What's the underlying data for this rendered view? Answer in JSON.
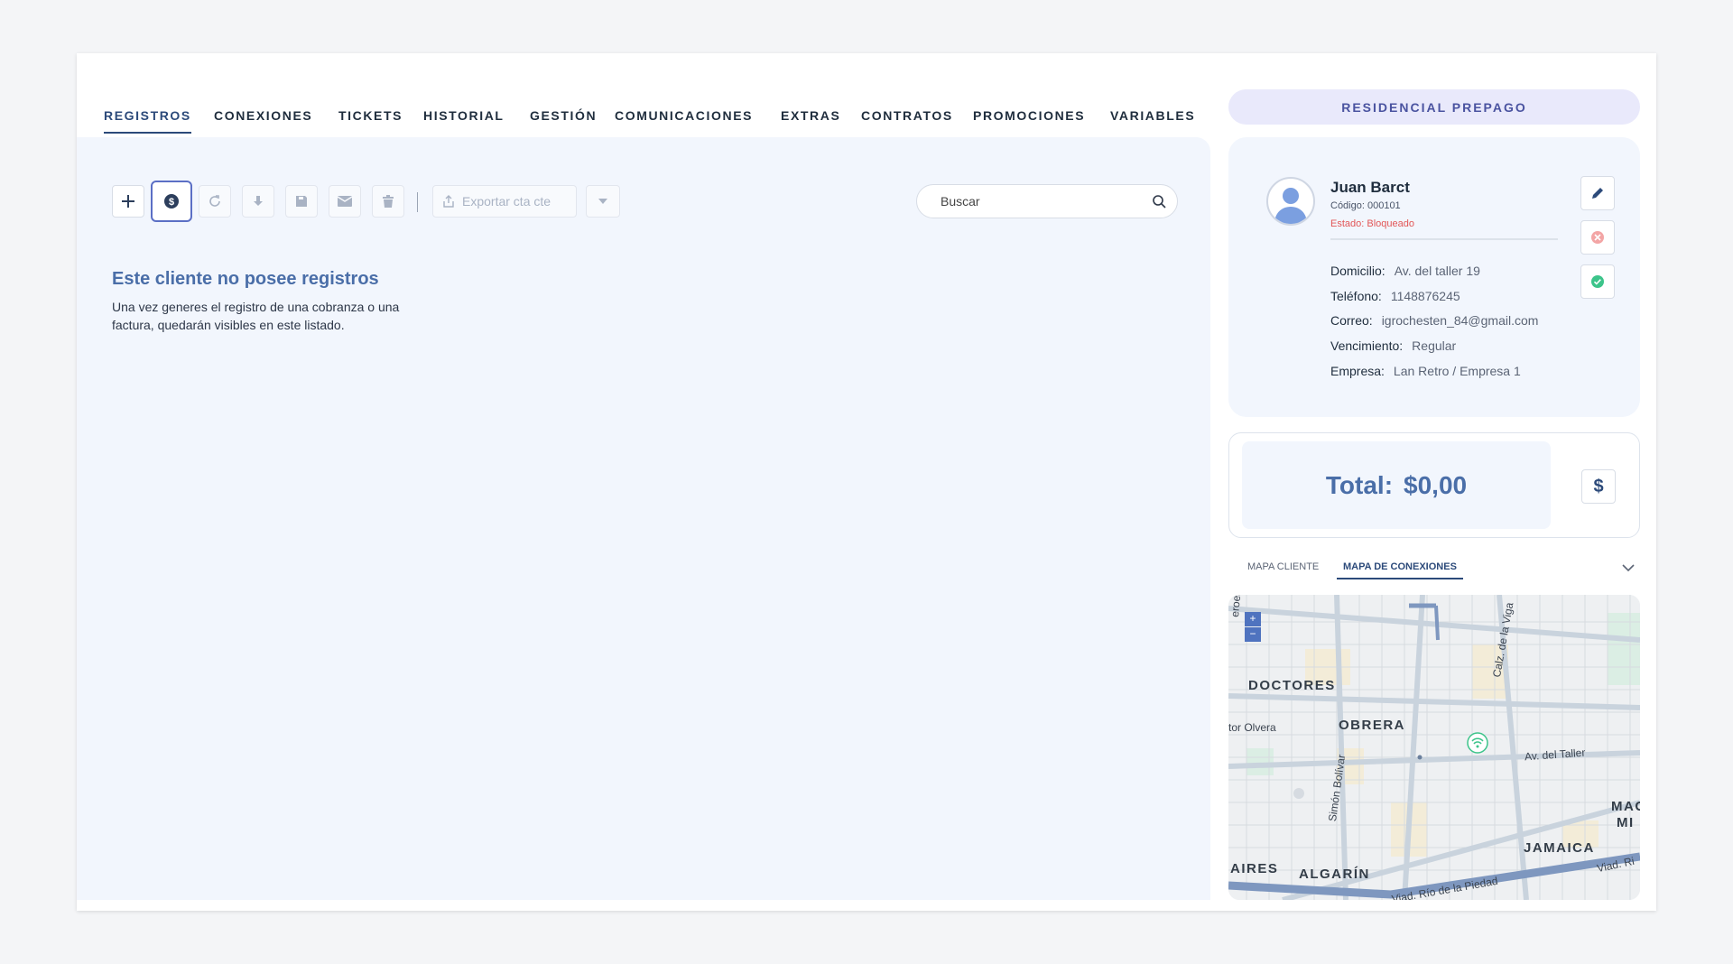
{
  "tabs": [
    "REGISTROS",
    "CONEXIONES",
    "TICKETS",
    "HISTORIAL",
    "GESTIÓN",
    "COMUNICACIONES",
    "EXTRAS",
    "CONTRATOS",
    "PROMOCIONES",
    "VARIABLES"
  ],
  "toolbar": {
    "icons": [
      "plus-icon",
      "dollar-circle-icon",
      "refresh-icon",
      "download-icon",
      "save-icon",
      "mail-icon",
      "trash-icon"
    ],
    "export_label": "Exportar cta cte",
    "search_placeholder": "Buscar"
  },
  "empty_state": {
    "title": "Este cliente no posee registros",
    "description": "Una vez generes el registro de una cobranza o una factura, quedarán visibles en este listado."
  },
  "plan": "RESIDENCIAL PREPAGO",
  "client": {
    "name": "Juan Barct",
    "code": "Código: 000101",
    "state": "Estado: Bloqueado",
    "fields": [
      {
        "label": "Domicilio:",
        "value": "Av. del taller 19"
      },
      {
        "label": "Teléfono:",
        "value": "1148876245"
      },
      {
        "label": "Correo:",
        "value": "igrochesten_84@gmail.com"
      },
      {
        "label": "Vencimiento:",
        "value": "Regular"
      },
      {
        "label": "Empresa:",
        "value": "Lan Retro / Empresa 1"
      }
    ]
  },
  "total": {
    "label": "Total:",
    "value": "$0,00",
    "button": "$"
  },
  "map_tabs": [
    "MAPA CLIENTE",
    "MAPA DE CONEXIONES"
  ],
  "map": {
    "zoom_in": "+",
    "zoom_out": "−",
    "neighborhoods": [
      "DOCTORES",
      "OBRERA",
      "JAMAICA",
      "ALGARÍN",
      "AIRES",
      "MAG",
      "MI"
    ],
    "streets": [
      "Calz. de la Viga",
      "tor Olvera",
      "Av. del Taller",
      "Simón Bolívar",
      "Viad. Río de la Piedad",
      "Viad. Ri",
      "eroes"
    ]
  },
  "colors": {
    "accent": "#2c4a7a",
    "link": "#4a6ea8",
    "danger": "#e25656",
    "success": "#3cc48a"
  }
}
